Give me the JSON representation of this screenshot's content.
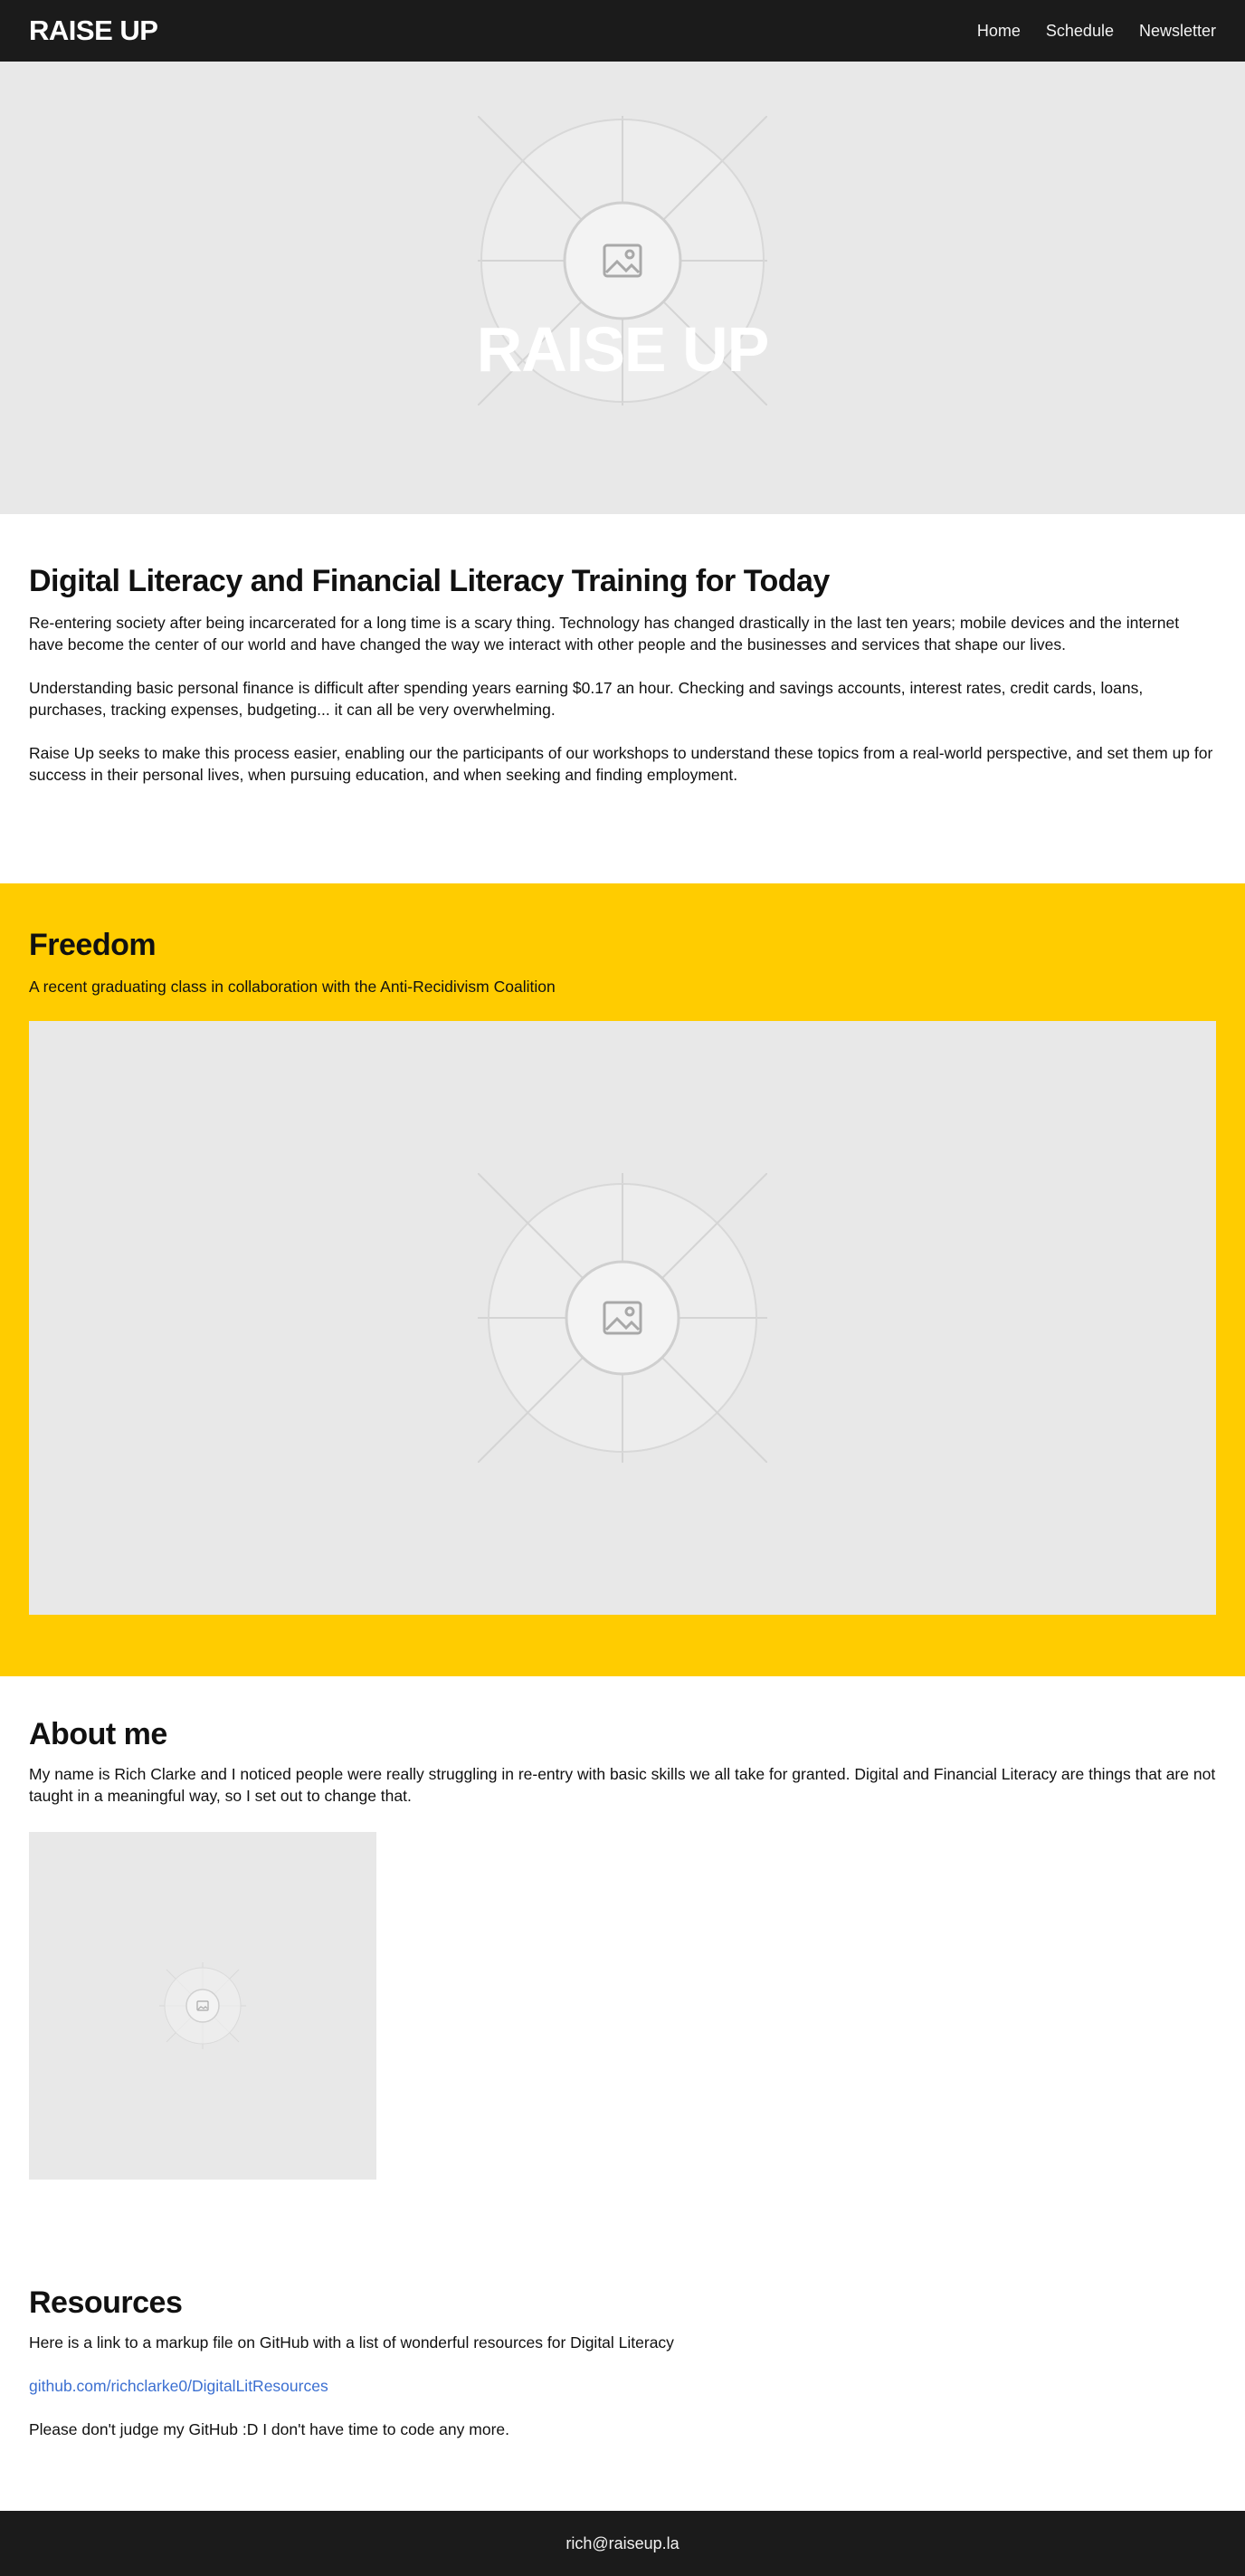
{
  "header": {
    "logo": "RAISE UP",
    "nav": [
      {
        "label": "Home"
      },
      {
        "label": "Schedule"
      },
      {
        "label": "Newsletter"
      }
    ]
  },
  "hero": {
    "title": "RAISE UP"
  },
  "intro": {
    "heading": "Digital Literacy and Financial Literacy Training for Today",
    "paragraphs": [
      "Re-entering society after being incarcerated for a long time is a scary thing. Technology has changed drastically in the last ten years; mobile devices and the internet have become the center of our world and have changed the way we interact with other people and the businesses and services that shape our lives.",
      "Understanding basic personal finance is difficult after spending years earning $0.17 an hour. Checking and savings accounts, interest rates, credit cards, loans, purchases, tracking expenses, budgeting... it can all be very overwhelming.",
      "Raise Up seeks to make this process easier, enabling our the participants of our workshops to understand these topics from a real-world perspective, and set them up for success in their personal lives, when pursuing education, and when seeking and finding employment."
    ]
  },
  "freedom": {
    "heading": "Freedom",
    "caption": "A recent graduating class in collaboration with the Anti-Recidivism Coalition"
  },
  "about": {
    "heading": "About me",
    "text": "My name is Rich Clarke and I noticed people were really struggling in re-entry with basic skills we all take for granted. Digital and Financial Literacy are things that are not taught in a meaningful way, so I set out to change that."
  },
  "resources": {
    "heading": "Resources",
    "intro": "Here is a link to a markup file on GitHub with a list of wonderful resources for Digital Literacy",
    "link": "github.com/richclarke0/DigitalLitResources",
    "note": "Please don't judge my GitHub :D I don't have time to code any more."
  },
  "footer": {
    "email": "rich@raiseup.la"
  },
  "colors": {
    "header_bg": "#1b1b1b",
    "accent_yellow": "#ffcc00",
    "placeholder_bg": "#e8e8e8",
    "link": "#3b6fd1"
  },
  "icons": {
    "image_placeholder": "image-placeholder-icon"
  }
}
